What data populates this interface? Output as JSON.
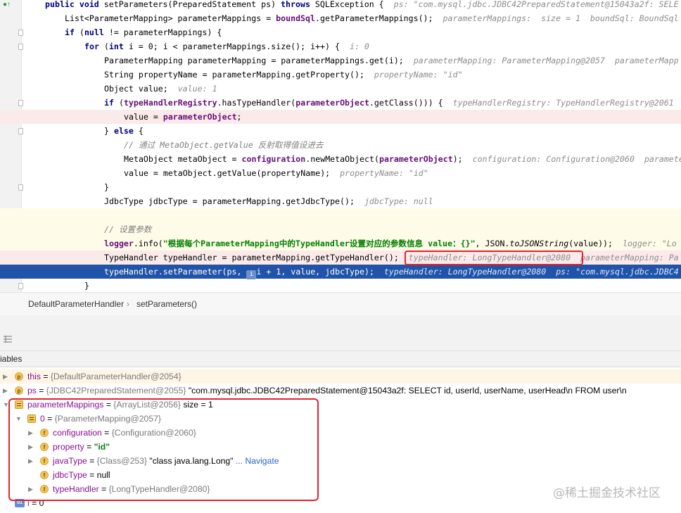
{
  "editor": {
    "lines": [
      {
        "k": "sig",
        "parts": [
          [
            "kw",
            "public void "
          ],
          [
            "",
            "setParameters(PreparedStatement ps) "
          ],
          [
            "kw",
            "throws "
          ],
          [
            "",
            "SQLException {  "
          ],
          [
            "hint",
            "ps: \"com.mysql.jdbc.JDBC42PreparedStatement@15043a2f: SELE"
          ]
        ]
      },
      {
        "k": "",
        "parts": [
          [
            "",
            "List<ParameterMapping> parameterMappings = "
          ],
          [
            "fld",
            "boundSql"
          ],
          [
            "",
            ".getParameterMappings();  "
          ],
          [
            "hint",
            "parameterMappings:  size = 1  boundSql: BoundSql"
          ]
        ]
      },
      {
        "k": "",
        "parts": [
          [
            "kw",
            "if "
          ],
          [
            "",
            "("
          ],
          [
            "kw",
            "null "
          ],
          [
            "",
            "!= parameterMappings) {"
          ]
        ]
      },
      {
        "k": "",
        "parts": [
          [
            "kw",
            "for "
          ],
          [
            "",
            "("
          ],
          [
            "kw",
            "int "
          ],
          [
            "",
            "i = "
          ],
          [
            "",
            "0"
          ],
          [
            "",
            "; i < parameterMappings.size(); i++) {  "
          ],
          [
            "hint",
            "i: 0"
          ]
        ]
      },
      {
        "k": "",
        "parts": [
          [
            "",
            "ParameterMapping parameterMapping = parameterMappings.get(i);  "
          ],
          [
            "hint",
            "parameterMapping: ParameterMapping@2057  parameterMapp"
          ]
        ]
      },
      {
        "k": "",
        "parts": [
          [
            "",
            "String propertyName = parameterMapping.getProperty();  "
          ],
          [
            "hint",
            "propertyName: \"id\""
          ]
        ]
      },
      {
        "k": "",
        "parts": [
          [
            "",
            "Object value;  "
          ],
          [
            "hint",
            "value: 1"
          ]
        ]
      },
      {
        "k": "",
        "parts": [
          [
            "kw",
            "if "
          ],
          [
            "",
            "("
          ],
          [
            "fld",
            "typeHandlerRegistry"
          ],
          [
            "",
            ".hasTypeHandler("
          ],
          [
            "fld",
            "parameterObject"
          ],
          [
            "",
            ".getClass())) {  "
          ],
          [
            "hint",
            "typeHandlerRegistry: TypeHandlerRegistry@2061"
          ]
        ]
      },
      {
        "k": "bp",
        "parts": [
          [
            "",
            "value = "
          ],
          [
            "fld",
            "parameterObject"
          ],
          [
            "",
            ";"
          ]
        ]
      },
      {
        "k": "",
        "parts": [
          [
            "",
            "} "
          ],
          [
            "kw",
            "else "
          ],
          [
            "",
            "{"
          ]
        ]
      },
      {
        "k": "",
        "parts": [
          [
            "cm",
            "// 通过 MetaObject.getValue 反射取得值设进去"
          ]
        ]
      },
      {
        "k": "",
        "parts": [
          [
            "",
            "MetaObject metaObject = "
          ],
          [
            "fld",
            "configuration"
          ],
          [
            "",
            ".newMetaObject("
          ],
          [
            "fld",
            "parameterObject"
          ],
          [
            "",
            ");  "
          ],
          [
            "hint",
            "configuration: Configuration@2060  paramete"
          ]
        ]
      },
      {
        "k": "",
        "parts": [
          [
            "",
            "value = metaObject.getValue(propertyName);  "
          ],
          [
            "hint",
            "propertyName: \"id\""
          ]
        ]
      },
      {
        "k": "",
        "parts": [
          [
            "",
            "}"
          ]
        ]
      },
      {
        "k": "",
        "parts": [
          [
            "",
            "JdbcType jdbcType = parameterMapping.getJdbcType();  "
          ],
          [
            "hint",
            "jdbcType: null"
          ]
        ]
      },
      {
        "k": "warm",
        "parts": [
          [
            "",
            ""
          ]
        ]
      },
      {
        "k": "warm",
        "parts": [
          [
            "cm",
            "// 设置参数"
          ]
        ]
      },
      {
        "k": "warm",
        "parts": [
          [
            "fld",
            "logger"
          ],
          [
            "",
            ".info("
          ],
          [
            "str",
            "\"根据每个ParameterMapping中的TypeHandler设置对应的参数信息 value：{}\""
          ],
          [
            "",
            ", JSON."
          ],
          [
            "ital",
            "toJSONString"
          ],
          [
            "",
            "(value));  "
          ],
          [
            "hint",
            "logger: \"Lo"
          ]
        ]
      },
      {
        "k": "bp",
        "parts": [
          [
            "",
            "TypeHandler typeHandler = parameterMapping.getTypeHandler();  "
          ],
          [
            "hint",
            "typeHandler: LongTypeHandler@2080  parameterMapping: Pa"
          ]
        ]
      },
      {
        "k": "exec",
        "parts": [
          [
            "",
            "typeHandler.setParameter(ps, "
          ],
          [
            "badge",
            "i"
          ],
          [
            "",
            "i + 1, value, jdbcType);  "
          ],
          [
            "hint",
            "typeHandler: LongTypeHandler@2080  ps: \"com.mysql.jdbc.JDBC4"
          ]
        ]
      },
      {
        "k": "",
        "parts": [
          [
            "",
            "}"
          ]
        ]
      }
    ]
  },
  "breadcrumb": {
    "class_name": "DefaultParameterHandler",
    "separator": "›",
    "method_name": "setParameters()"
  },
  "variables": {
    "header": "iables",
    "rows": [
      {
        "icon": "p",
        "name": "this",
        "eq": " = ",
        "val": "{DefaultParameterHandler@2054}",
        "extra": ""
      },
      {
        "icon": "p",
        "name": "ps",
        "eq": " = ",
        "val": "{JDBC42PreparedStatement@2055}",
        "extra": " \"com.mysql.jdbc.JDBC42PreparedStatement@15043a2f: SELECT id, userId, userName, userHead\\n         FROM user\\n"
      },
      {
        "icon": "list",
        "name": "parameterMappings",
        "eq": " = ",
        "val": "{ArrayList@2056}",
        "extra": "  size = 1"
      },
      {
        "icon": "list",
        "name": "0",
        "eq": " = ",
        "val": "{ParameterMapping@2057}",
        "extra": ""
      },
      {
        "icon": "f",
        "name": "configuration",
        "eq": " = ",
        "val": "{Configuration@2060}",
        "extra": ""
      },
      {
        "icon": "f",
        "name": "property",
        "eq": " = ",
        "val": "",
        "str": "\"id\"",
        "extra": ""
      },
      {
        "icon": "f",
        "name": "javaType",
        "eq": " = ",
        "val": "{Class@253}",
        "extra": " \"class java.lang.Long\"",
        "nav": " ... Navigate"
      },
      {
        "icon": "f",
        "name": "jdbcType",
        "eq": " = ",
        "val": "",
        "extra": "null"
      },
      {
        "icon": "f",
        "name": "typeHandler",
        "eq": " = ",
        "val": "{LongTypeHandler@2080}",
        "extra": ""
      },
      {
        "icon": "prim",
        "name": "i",
        "eq": " = ",
        "val": "",
        "extra": "0"
      }
    ]
  },
  "watermark": "@稀土掘金技术社区",
  "colors": {
    "accent": "#e5202c",
    "exec_line": "#2154a8",
    "breakpoint": "#d33c3c"
  }
}
